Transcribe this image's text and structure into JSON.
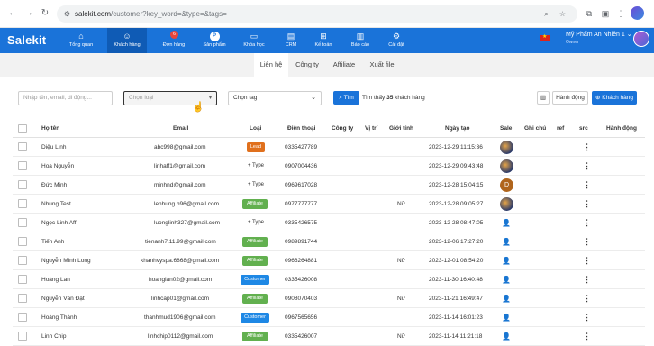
{
  "browser": {
    "url_host": "salekit.com",
    "url_path": "/customer?key_word=&type=&tags="
  },
  "app": {
    "logo": "Salekit",
    "nav": [
      {
        "label": "Tổng quan",
        "icon": "home-icon"
      },
      {
        "label": "Khách hàng",
        "icon": "users-icon"
      },
      {
        "label": "Đơn hàng",
        "icon": "order-icon",
        "badge": "6"
      },
      {
        "label": "Sản phẩm",
        "icon": "product-icon"
      },
      {
        "label": "Khóa học",
        "icon": "course-icon"
      },
      {
        "label": "CRM",
        "icon": "crm-icon"
      },
      {
        "label": "Kế toán",
        "icon": "accounting-icon"
      },
      {
        "label": "Báo cáo",
        "icon": "report-icon"
      },
      {
        "label": "Cài đặt",
        "icon": "settings-icon"
      }
    ],
    "user": {
      "name": "Mỹ Phẩm An Nhiên 1",
      "role": "Owner"
    }
  },
  "subtabs": [
    "Liên hệ",
    "Công ty",
    "Affiliate",
    "Xuất file"
  ],
  "filters": {
    "search_placeholder": "Nhập tên, email, di động...",
    "type_placeholder": "Chọn loại",
    "tag_placeholder": "Chọn tag",
    "search_button": "Tìm",
    "found_prefix": "Tìm thấy",
    "found_count": "35",
    "found_suffix": "khách hàng",
    "action_button": "Hành động",
    "add_button": "Khách hàng"
  },
  "table": {
    "columns": [
      "Họ tên",
      "Email",
      "Loại",
      "Điện thoại",
      "Công ty",
      "Vị trí",
      "Giới tính",
      "Ngày tạo",
      "Sale",
      "Ghi chú",
      "ref",
      "src",
      "Hành động"
    ],
    "rows": [
      {
        "name": "Diệu Linh",
        "email": "abc998@gmail.com",
        "type": "Lead",
        "phone": "0335427789",
        "gender": "",
        "created": "2023-12-29 11:15:36",
        "sale": "avatar"
      },
      {
        "name": "Hoa Nguyễn",
        "email": "linhaff1@gmail.com",
        "type": "+ Type",
        "phone": "0907004436",
        "gender": "",
        "created": "2023-12-29 09:43:48",
        "sale": "avatar"
      },
      {
        "name": "Đức Minh",
        "email": "minhnd@gmail.com",
        "type": "+ Type",
        "phone": "0969617028",
        "gender": "",
        "created": "2023-12-28 15:04:15",
        "sale": "D"
      },
      {
        "name": "Nhung Test",
        "email": "lenhung.h96@gmail.com",
        "type": "Affiliate",
        "phone": "0977777777",
        "gender": "Nữ",
        "created": "2023-12-28 09:05:27",
        "sale": "avatar"
      },
      {
        "name": "Ngọc Linh Aff",
        "email": "luonglinh327@gmail.com",
        "type": "+ Type",
        "phone": "0335426575",
        "gender": "",
        "created": "2023-12-28 08:47:05",
        "sale": "icon"
      },
      {
        "name": "Tiến Anh",
        "email": "tienanh7.11.99@gmail.com",
        "type": "Affiliate",
        "phone": "0989891744",
        "gender": "",
        "created": "2023-12-06 17:27:20",
        "sale": "icon"
      },
      {
        "name": "Nguyễn Minh Long",
        "email": "khanhvyspa.6868@gmail.com",
        "type": "Affiliate",
        "phone": "0966264881",
        "gender": "Nữ",
        "created": "2023-12-01 08:54:20",
        "sale": "icon"
      },
      {
        "name": "Hoàng Lan",
        "email": "hoanglan02@gmail.com",
        "type": "Customer",
        "phone": "0335426008",
        "gender": "",
        "created": "2023-11-30 16:40:48",
        "sale": "icon"
      },
      {
        "name": "Nguyễn Văn Đạt",
        "email": "linhcap01@gmail.com",
        "type": "Affiliate",
        "phone": "0908070403",
        "gender": "Nữ",
        "created": "2023-11-21 16:49:47",
        "sale": "icon"
      },
      {
        "name": "Hoàng Thành",
        "email": "thanhmud1906@gmail.com",
        "type": "Customer",
        "phone": "0967565656",
        "gender": "",
        "created": "2023-11-14 16:01:23",
        "sale": "icon"
      },
      {
        "name": "Linh Chip",
        "email": "linhchip0112@gmail.com",
        "type": "Affiliate",
        "phone": "0335426007",
        "gender": "Nữ",
        "created": "2023-11-14 11:21:18",
        "sale": "icon"
      }
    ]
  },
  "colors": {
    "primary": "#1a73d9",
    "lead": "#e0701d",
    "affiliate": "#62b04f",
    "customer": "#1e88e5"
  }
}
